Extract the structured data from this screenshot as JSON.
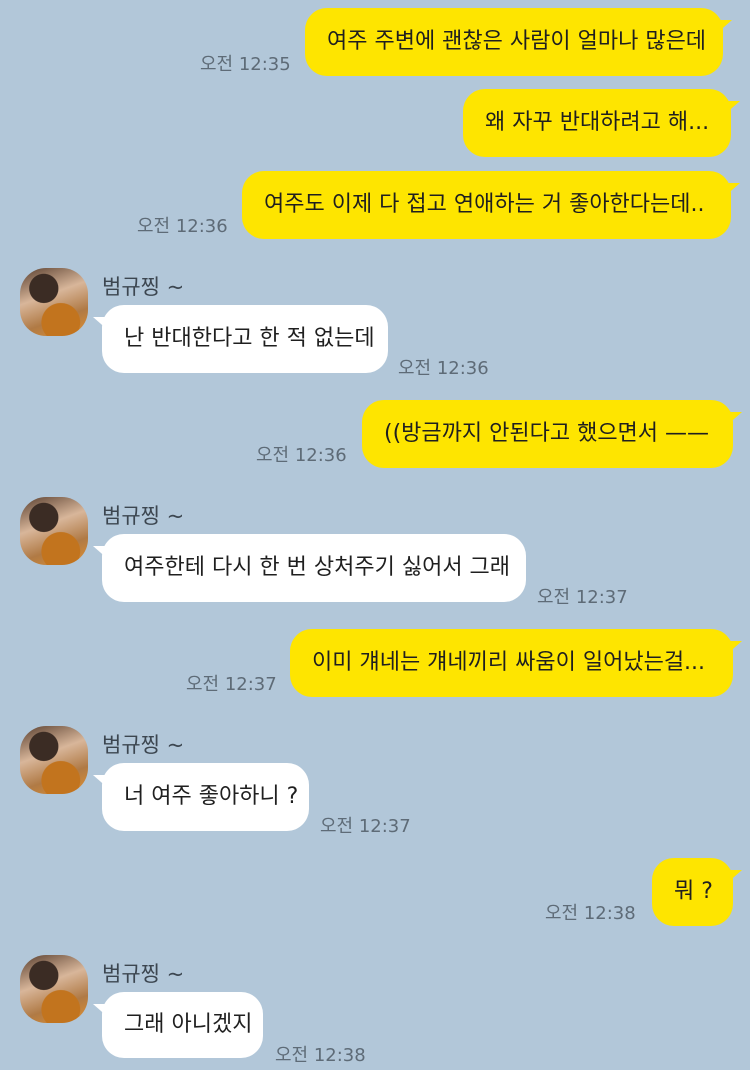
{
  "contact": {
    "name": "범규찡 ~"
  },
  "messages": [
    {
      "from": "me",
      "text": "여주 주변에 괜찮은 사람이 얼마나 많은데",
      "time": "오전 12:35"
    },
    {
      "from": "me",
      "text": "왜 자꾸 반대하려고 해...",
      "time": ""
    },
    {
      "from": "me",
      "text": "여주도 이제 다 접고 연애하는 거 좋아한다는데..",
      "time": "오전 12:36"
    },
    {
      "from": "them",
      "text": "난 반대한다고 한 적 없는데",
      "time": "오전 12:36"
    },
    {
      "from": "me",
      "text": "((방금까지 안된다고 했으면서 ——",
      "time": "오전 12:36"
    },
    {
      "from": "them",
      "text": "여주한테 다시 한 번 상처주기 싫어서 그래",
      "time": "오전 12:37"
    },
    {
      "from": "me",
      "text": "이미 걔네는 걔네끼리 싸움이 일어났는걸...",
      "time": "오전 12:37"
    },
    {
      "from": "them",
      "text": "너 여주 좋아하니 ?",
      "time": "오전 12:37"
    },
    {
      "from": "me",
      "text": "뭐 ?",
      "time": "오전 12:38"
    },
    {
      "from": "them",
      "text": "그래 아니겠지",
      "time": "오전 12:38"
    }
  ],
  "colors": {
    "background": "#b2c7d9",
    "my_bubble": "#fee500",
    "their_bubble": "#ffffff"
  }
}
